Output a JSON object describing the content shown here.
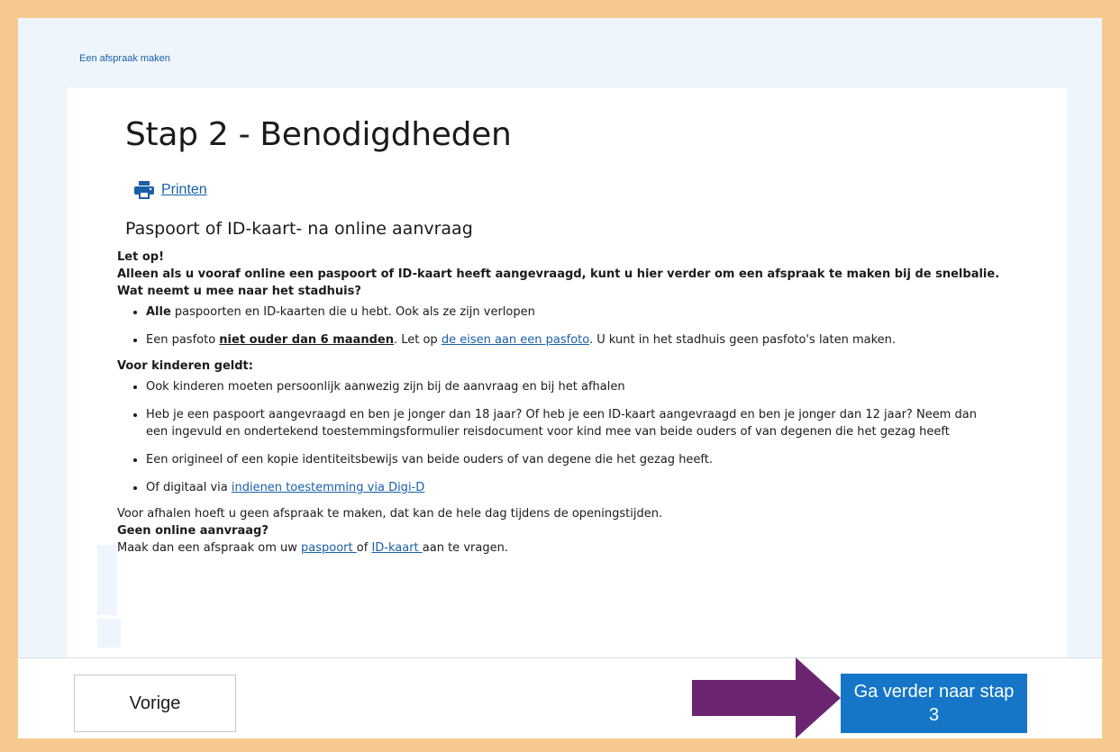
{
  "breadcrumb": "Een afspraak maken",
  "page_title": "Stap 2 - Benodigdheden",
  "print": {
    "label": "Printen",
    "icon": "printer-icon"
  },
  "section_title": "Paspoort of ID-kaart- na online aanvraag",
  "notice": {
    "heading": "Let op!",
    "text": "Alleen als u vooraf online een paspoort of ID-kaart heeft aangevraagd, kunt u hier verder om een afspraak te maken bij de snelbalie.",
    "question": "Wat neemt u mee naar het stadhuis?"
  },
  "bring_list": {
    "item1_bold": "Alle",
    "item1_rest": " paspoorten en ID-kaarten die u hebt. Ook als ze zijn verlopen",
    "item2_pre": "Een pasfoto ",
    "item2_bold": "niet ouder dan 6 maanden",
    "item2_mid": ". Let op ",
    "item2_link": "de eisen aan een pasfoto",
    "item2_post": ". U kunt in het stadhuis geen pasfoto's laten maken."
  },
  "children": {
    "heading": "Voor kinderen geldt:",
    "item1": "Ook kinderen moeten persoonlijk aanwezig zijn bij de aanvraag en bij het afhalen",
    "item2_line1": "Heb je een paspoort aangevraagd en ben je jonger dan 18 jaar? Of heb je een ID-kaart aangevraagd en ben je jonger dan 12 jaar? Neem dan",
    "item2_line2": "een ingevuld en ondertekend toestemmingsformulier reisdocument voor kind mee van beide ouders of van degenen die het gezag heeft",
    "item3": "Een origineel of een kopie identiteitsbewijs van beide ouders of van degene die het gezag heeft.",
    "item4_pre": "Of digitaal via ",
    "item4_link": "indienen toestemming via Digi-D"
  },
  "pickup_text": "Voor afhalen hoeft u geen afspraak te maken, dat kan de hele dag tijdens de openingstijden.",
  "no_online": {
    "heading": "Geen online aanvraag?",
    "pre": "Maak dan een afspraak om uw ",
    "link1": "paspoort ",
    "mid": "of ",
    "link2": "ID-kaart ",
    "post": "aan te vragen."
  },
  "footer": {
    "prev_label": "Vorige",
    "next_label": "Ga verder naar stap 3"
  },
  "colors": {
    "frame": "#f6c98f",
    "page_bg": "#eef5fd",
    "link": "#1a5fa8",
    "primary_button": "#1576c8",
    "annotation_arrow": "#6b2570"
  }
}
